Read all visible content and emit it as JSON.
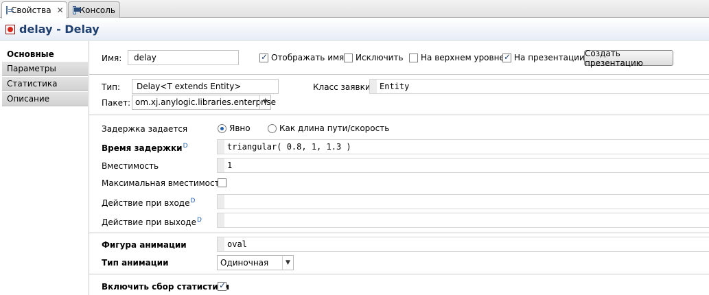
{
  "tabs": [
    {
      "label": "Свойства",
      "icon": "properties-icon",
      "active": true
    },
    {
      "label": "Консоль",
      "icon": "console-icon",
      "active": false
    }
  ],
  "close_glyph": "✕",
  "header": {
    "title": "delay - Delay",
    "icon": "delay-block-icon"
  },
  "nav": {
    "items": [
      "Основные",
      "Параметры",
      "Статистика",
      "Описание"
    ],
    "active": "Основные"
  },
  "main": {
    "name_label": "Имя:",
    "name_value": "delay",
    "show_name_label": "Отображать имя",
    "exclude_label": "Исключить",
    "top_level_label": "На верхнем уровне",
    "on_presentation_label": "На презентации",
    "create_presentation_button": "Создать презентацию",
    "type_label": "Тип:",
    "type_value": "Delay<T extends Entity>",
    "request_class_label": "Класс заявки:",
    "request_class_value": "Entity",
    "package_label": "Пакет:",
    "package_value": "om.xj.anylogic.libraries.enterprise",
    "delay_specified_label": "Задержка задается",
    "radio_explicit": "Явно",
    "radio_path_length": "Как длина пути/скорость",
    "delay_time_label": "Время задержки",
    "delay_time_value": "triangular( 0.8, 1, 1.3 )",
    "capacity_label": "Вместимость",
    "capacity_value": "1",
    "max_capacity_label": "Максимальная вместимость",
    "on_enter_label": "Действие при входе",
    "on_enter_value": "",
    "on_exit_label": "Действие при выходе",
    "on_exit_value": "",
    "anim_shape_label": "Фигура анимации",
    "anim_shape_value": "oval",
    "anim_type_label": "Тип анимации",
    "anim_type_value": "Одиночная",
    "collect_stats_label": "Включить сбор статистики",
    "dynamic_marker": "D"
  },
  "checkbox_states": {
    "show_name": true,
    "exclude": false,
    "top_level": false,
    "on_presentation": true,
    "max_capacity": false,
    "collect_stats": true
  }
}
